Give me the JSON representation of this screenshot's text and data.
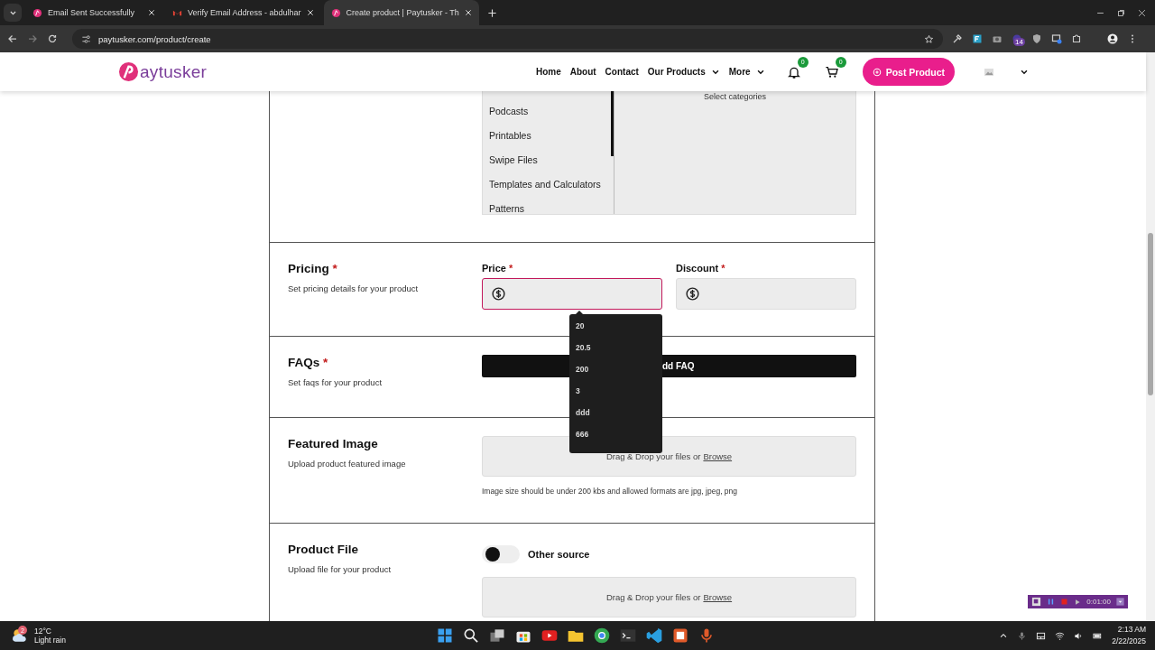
{
  "browser": {
    "tabs": [
      {
        "title": "Email Sent Successfully",
        "selected": false
      },
      {
        "title": "Verify Email Address - abdulhar",
        "selected": false
      },
      {
        "title": "Create product | Paytusker - Th",
        "selected": true
      }
    ],
    "url": "paytusker.com/product/create",
    "extension_badge": "14"
  },
  "header": {
    "logo": "aytusker",
    "nav": [
      {
        "label": "Home",
        "dropdown": false
      },
      {
        "label": "About",
        "dropdown": false
      },
      {
        "label": "Contact",
        "dropdown": false
      },
      {
        "label": "Our Products",
        "dropdown": true
      },
      {
        "label": "More",
        "dropdown": true
      }
    ],
    "notifications": "0",
    "cart": "0",
    "post_button": "Post Product"
  },
  "categories": {
    "items": [
      "Podcasts",
      "Printables",
      "Swipe Files",
      "Templates and Calculators",
      "Patterns"
    ],
    "placeholder": "Select categories"
  },
  "sections": [
    {
      "kind": "pricing",
      "title": "Pricing",
      "mark": "*",
      "description": "Set pricing details for your product",
      "fields": [
        {
          "label": "Price",
          "mark": "*",
          "focused": true
        },
        {
          "label": "Discount",
          "mark": "*",
          "focused": false
        }
      ],
      "suggestions": [
        "20",
        "20.5",
        "200",
        "3",
        "ddd",
        "666"
      ]
    },
    {
      "kind": "faqs",
      "title": "FAQs",
      "mark": "*",
      "description": "Set faqs for your product",
      "button": "dd FAQ"
    },
    {
      "kind": "upload",
      "title": "Featured Image",
      "description": "Upload product featured image",
      "drop_text": "Drag & Drop your files or",
      "link": "Browse",
      "note": "Image size should be under 200 kbs and allowed formats are jpg, jpeg, png"
    },
    {
      "kind": "file",
      "title": "Product File",
      "description": "Upload file for your product",
      "toggle": {
        "label": "Other source",
        "on": false
      },
      "drop_text": "Drag & Drop your files or",
      "link": "Browse"
    }
  ],
  "recorder": {
    "time": "0:01:00"
  },
  "taskbar": {
    "weather": {
      "badge": "2",
      "temperature": "12°C",
      "condition": "Light rain"
    },
    "time": "2:13 AM",
    "date": "2/22/2025"
  }
}
